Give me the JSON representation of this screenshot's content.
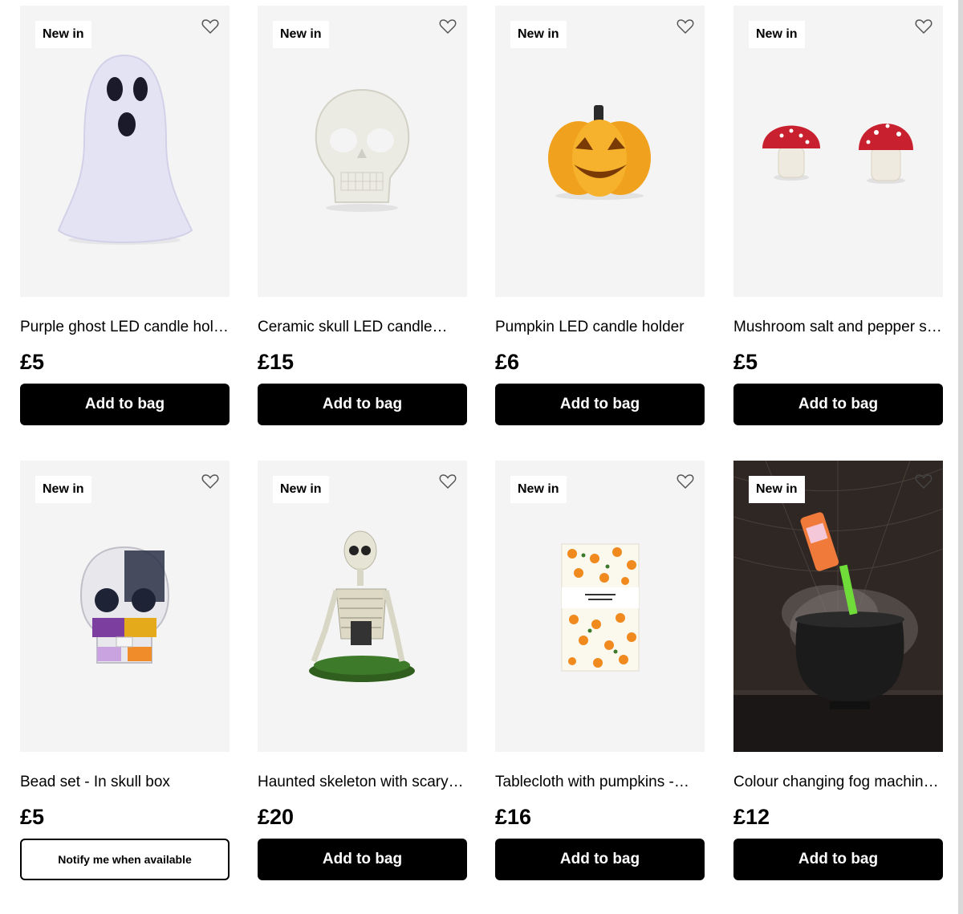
{
  "badge_text": "New in",
  "products": [
    {
      "name": "Purple ghost LED candle holder",
      "price": "£5",
      "button": "Add to bag",
      "image": "ghost-image"
    },
    {
      "name": "Ceramic skull LED candle…",
      "price": "£15",
      "button": "Add to bag",
      "image": "skull-image"
    },
    {
      "name": "Pumpkin LED candle holder",
      "price": "£6",
      "button": "Add to bag",
      "image": "pumpkin-image"
    },
    {
      "name": "Mushroom salt and pepper s…",
      "price": "£5",
      "button": "Add to bag",
      "image": "mushroom-image"
    },
    {
      "name": "Bead set - In skull box",
      "price": "£5",
      "button": "Notify me when available",
      "image": "bead-skull-image"
    },
    {
      "name": "Haunted skeleton with scary…",
      "price": "£20",
      "button": "Add to bag",
      "image": "skeleton-image"
    },
    {
      "name": "Tablecloth with pumpkins -…",
      "price": "£16",
      "button": "Add to bag",
      "image": "tablecloth-image"
    },
    {
      "name": "Colour changing fog machin…",
      "price": "£12",
      "button": "Add to bag",
      "image": "fog-cauldron-image"
    }
  ],
  "icons": {
    "wishlist": "heart-icon"
  }
}
